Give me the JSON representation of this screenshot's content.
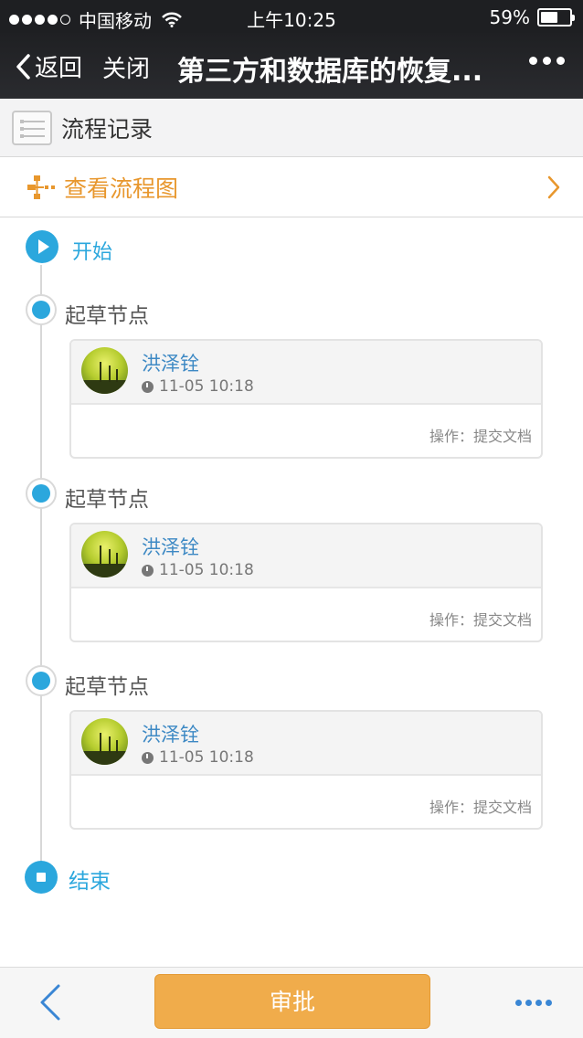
{
  "status_bar": {
    "carrier": "中国移动",
    "time": "上午10:25",
    "battery": "59%",
    "battery_level": 0.59
  },
  "nav": {
    "back_label": "返回",
    "close_label": "关闭",
    "title": "第三方和数据库的恢复..."
  },
  "section": {
    "title": "流程记录"
  },
  "flowchart_link": {
    "label": "查看流程图"
  },
  "timeline": {
    "start_label": "开始",
    "end_label": "结束",
    "steps": [
      {
        "node_label": "起草节点",
        "user": "洪泽铨",
        "time": "11-05 10:18",
        "action": "操作：提交文档"
      },
      {
        "node_label": "起草节点",
        "user": "洪泽铨",
        "time": "11-05 10:18",
        "action": "操作：提交文档"
      },
      {
        "node_label": "起草节点",
        "user": "洪泽铨",
        "time": "11-05 10:18",
        "action": "操作：提交文档"
      }
    ]
  },
  "bottom_bar": {
    "approve_label": "审批"
  },
  "colors": {
    "accent_blue": "#2ba7dd",
    "accent_orange": "#e8972d",
    "button_orange": "#f0ac4b",
    "nav_bg": "#1f2023"
  }
}
